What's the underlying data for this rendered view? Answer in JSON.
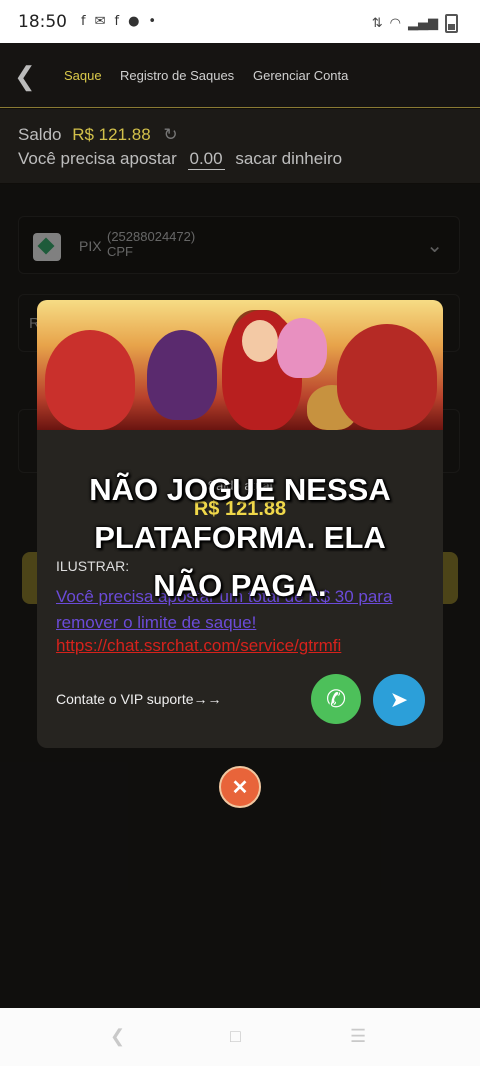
{
  "status_bar": {
    "time": "18:50",
    "notification_icons": [
      "facebook-icon",
      "messenger-icon",
      "facebook-icon",
      "chat-icon",
      "dot-icon"
    ]
  },
  "nav": {
    "tabs": [
      {
        "label": "Saque",
        "active": true
      },
      {
        "label": "Registro de Saques",
        "active": false
      },
      {
        "label": "Gerenciar Conta",
        "active": false
      }
    ]
  },
  "balance": {
    "label": "Saldo",
    "amount": "R$ 121.88",
    "bet_prefix": "Você precisa apostar",
    "bet_value": "0.00",
    "bet_suffix": "sacar dinheiro"
  },
  "form": {
    "pix_label": "PIX",
    "pix_number": "(25288024472)",
    "pix_type": "CPF",
    "field1_initial": "R"
  },
  "popup": {
    "saldo_label": "Saldo atual",
    "saldo_amount": "R$ 121.88",
    "ilustrar": "ILUSTRAR:",
    "message": "Você precisa apostar um total de R$ 30 para remover o limite de saque!",
    "link": "https://chat.ssrchat.com/service/gtrmfi",
    "vip_text": "Contate o VIP suporte→→"
  },
  "overlay_caption": {
    "line1": "NÃO JOGUE NESSA",
    "line2": "PLATAFORMA. ELA",
    "line3": "NÃO PAGA."
  },
  "colors": {
    "accent_gold": "#d9c94a",
    "whatsapp": "#4dc05a",
    "telegram": "#2c9fd9",
    "close": "#e8643a"
  }
}
